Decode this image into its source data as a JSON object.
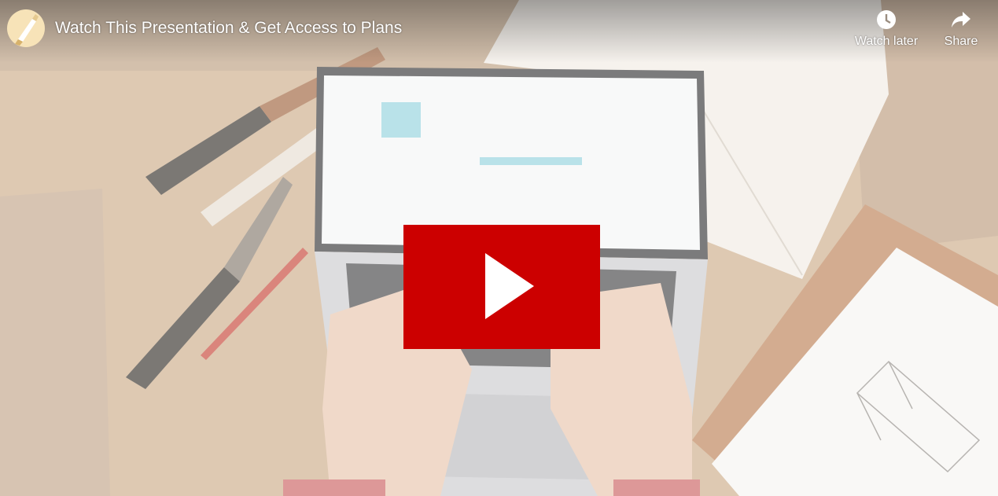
{
  "video": {
    "title": "Watch This Presentation & Get Access to Plans",
    "play_button_color": "#cc0000"
  },
  "controls": {
    "watch_later_label": "Watch later",
    "watch_later_icon": "clock-icon",
    "share_label": "Share",
    "share_icon": "share-arrow-icon"
  },
  "channel": {
    "avatar_icon": "paintbrush-icon"
  },
  "play": {
    "icon": "play-icon"
  }
}
